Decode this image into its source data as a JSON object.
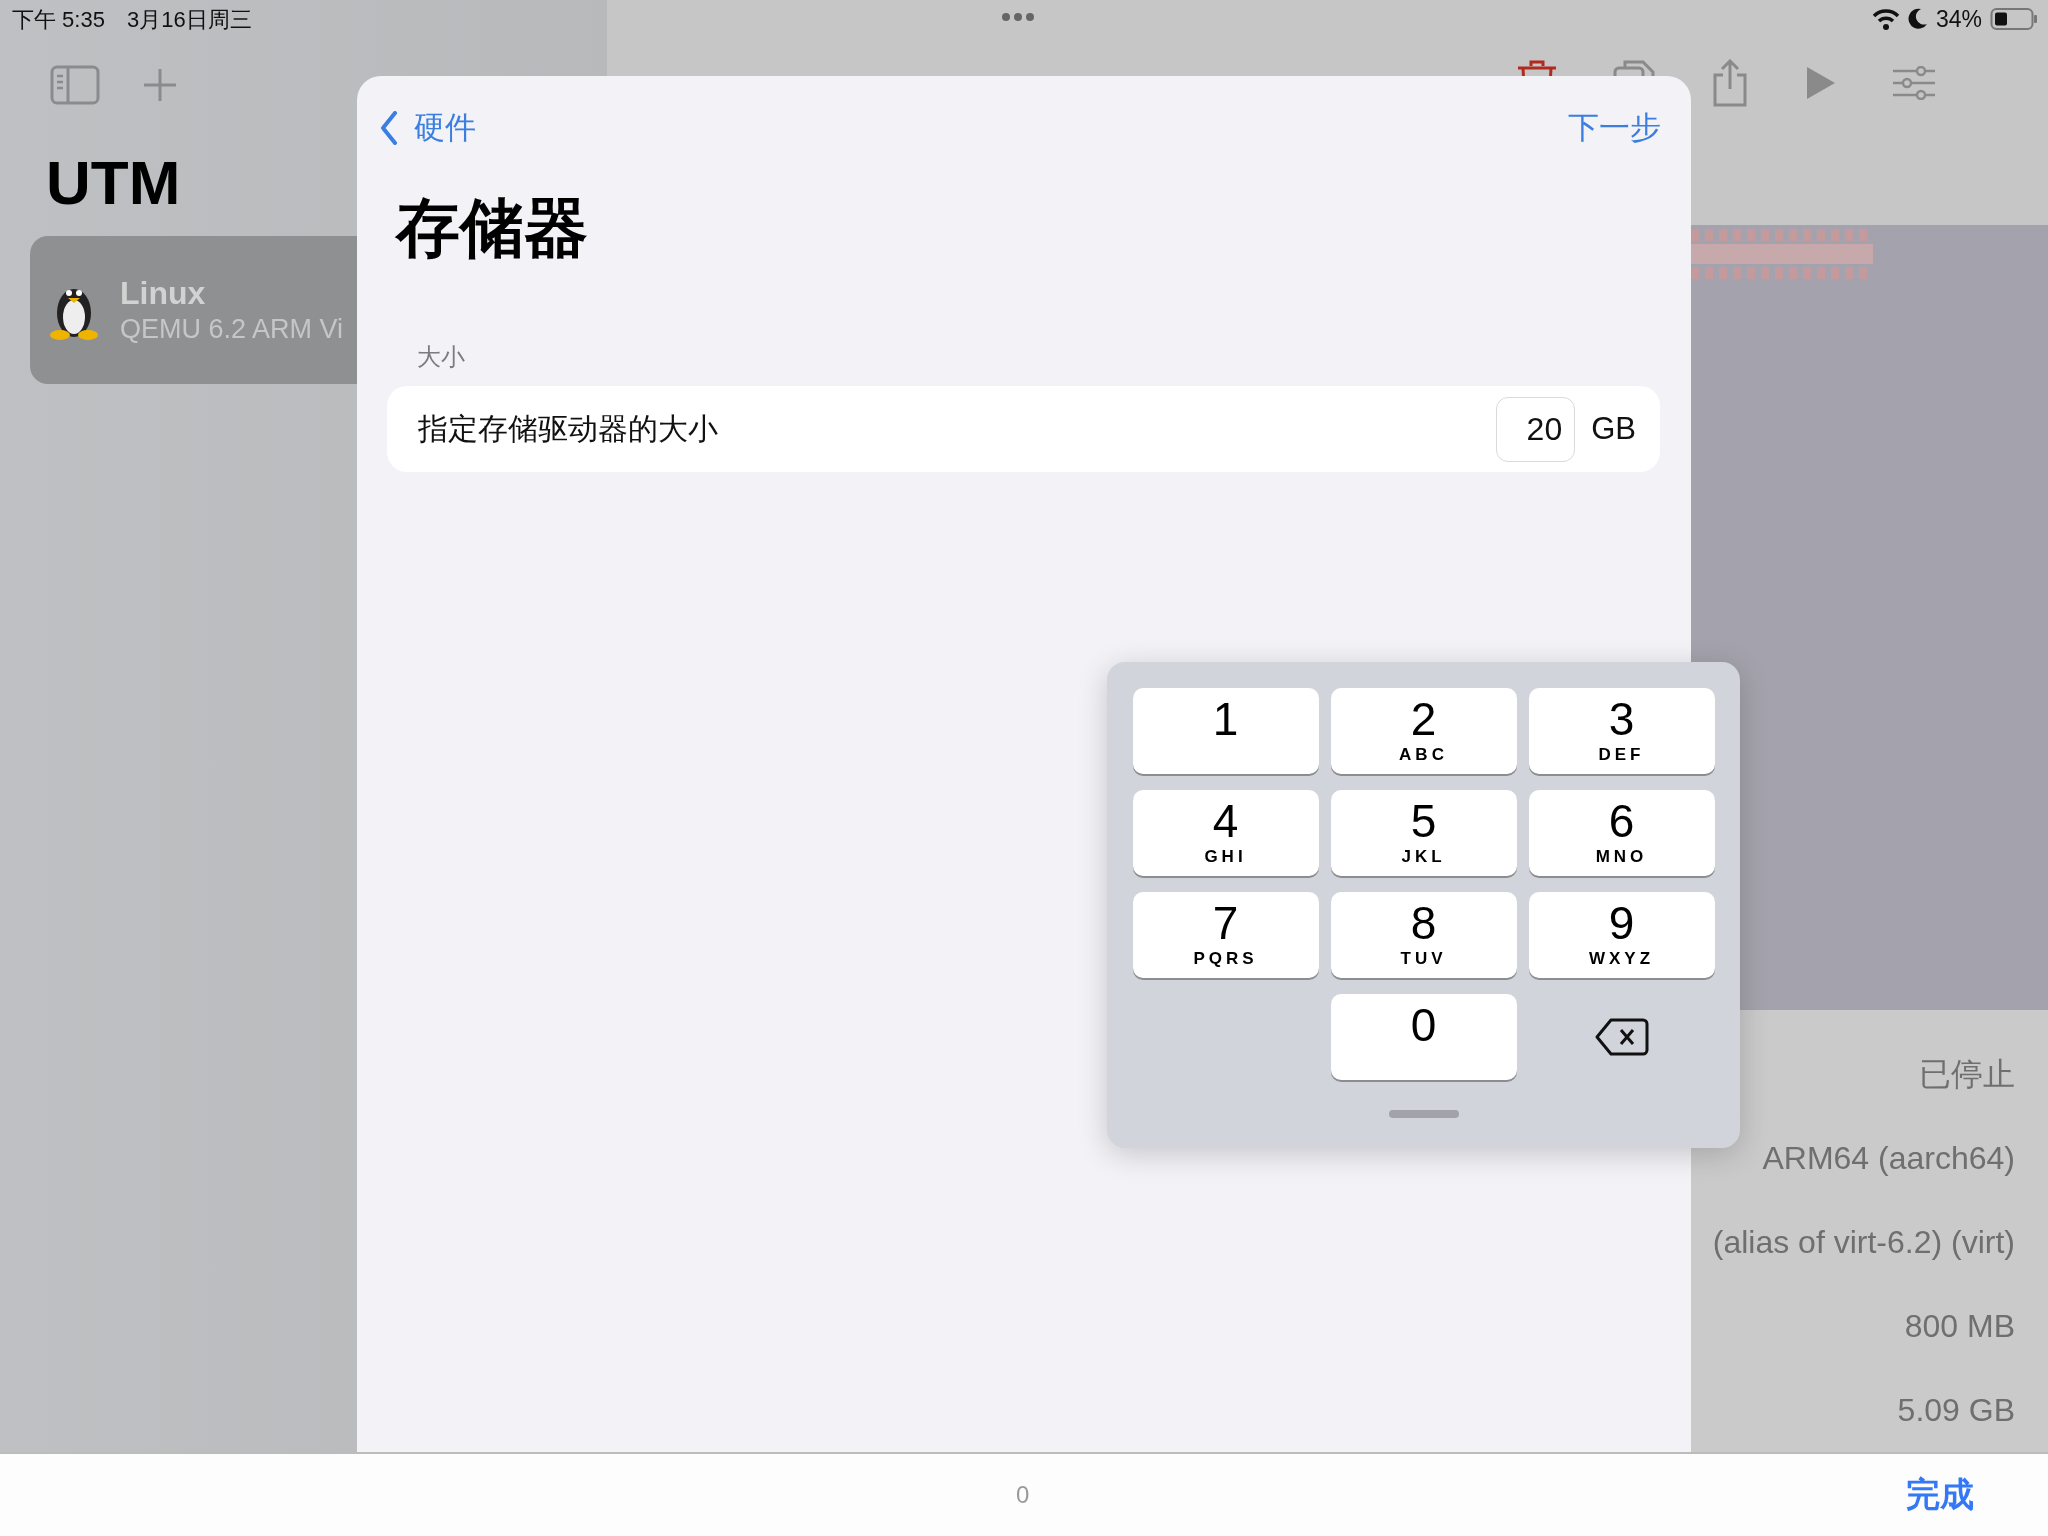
{
  "status_bar": {
    "time": "下午 5:35",
    "date": "3月16日周三",
    "battery": "34%"
  },
  "sidebar": {
    "title": "UTM",
    "items": [
      {
        "name": "Linux",
        "subtitle": "QEMU 6.2 ARM Vi",
        "selected": true
      }
    ]
  },
  "detail": {
    "values": [
      "已停止",
      "ARM64 (aarch64)",
      "(alias of virt-6.2) (virt)",
      "800 MB",
      "5.09 GB"
    ]
  },
  "sheet": {
    "back": "硬件",
    "next": "下一步",
    "title": "存储器",
    "section": "大小",
    "row": {
      "label": "指定存储驱动器的大小",
      "value": "20",
      "unit": "GB"
    }
  },
  "keypad": {
    "keys": [
      {
        "kind": "digit",
        "digit": "1"
      },
      {
        "kind": "digit",
        "digit": "2",
        "letters": "ABC"
      },
      {
        "kind": "digit",
        "digit": "3",
        "letters": "DEF"
      },
      {
        "kind": "digit",
        "digit": "4",
        "letters": "GHI"
      },
      {
        "kind": "digit",
        "digit": "5",
        "letters": "JKL"
      },
      {
        "kind": "digit",
        "digit": "6",
        "letters": "MNO"
      },
      {
        "kind": "digit",
        "digit": "7",
        "letters": "PQRS"
      },
      {
        "kind": "digit",
        "digit": "8",
        "letters": "TUV"
      },
      {
        "kind": "digit",
        "digit": "9",
        "letters": "WXYZ"
      },
      {
        "kind": "blank"
      },
      {
        "kind": "digit",
        "digit": "0"
      },
      {
        "kind": "delete"
      }
    ]
  },
  "accessory_bar": {
    "value": "0",
    "done": "完成"
  }
}
